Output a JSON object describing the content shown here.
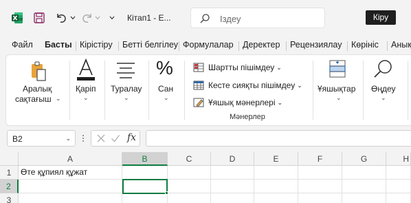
{
  "titlebar": {
    "app_icon": "excel-logo-icon",
    "doc_title": "Кітап1  -  Е...",
    "search_placeholder": "Іздеу",
    "signin_label": "Кіру"
  },
  "tabs": [
    {
      "label": "Файл"
    },
    {
      "label": "Басты"
    },
    {
      "label": "Кірістіру"
    },
    {
      "label": "Бетті белгілеу"
    },
    {
      "label": "Формулалар"
    },
    {
      "label": "Деректер"
    },
    {
      "label": "Рецензиялау"
    },
    {
      "label": "Көрініс"
    },
    {
      "label": "Анықтама"
    }
  ],
  "ribbon": {
    "clipboard_label_line1": "Аралық",
    "clipboard_label_line2": "сақтағыш",
    "font_label": "Қаріп",
    "alignment_label": "Туралау",
    "number_label": "Сан",
    "number_symbol": "%",
    "styles": [
      {
        "label": "Шартты пішімдеу"
      },
      {
        "label": "Кесте сияқты пішімдеу"
      },
      {
        "label": "Ұяшық мәнерлері"
      }
    ],
    "styles_group_label": "Мәнерлер",
    "cells_label": "Ұяшықтар",
    "editing_label": "Өңдеу"
  },
  "formulabar": {
    "name_box": "B2",
    "fx_label": "fx",
    "formula_value": ""
  },
  "grid": {
    "columns": [
      "A",
      "B",
      "C",
      "D",
      "E",
      "F",
      "G",
      "H"
    ],
    "rows": [
      "1",
      "2",
      "3"
    ],
    "active_column": "B",
    "active_row": "2",
    "cells": {
      "A1": "Өте құпиял құжат"
    }
  },
  "colors": {
    "accent": "#107c41",
    "titlebar_bg": "#f3f3f3",
    "ribbon_bg": "#ffffff"
  }
}
